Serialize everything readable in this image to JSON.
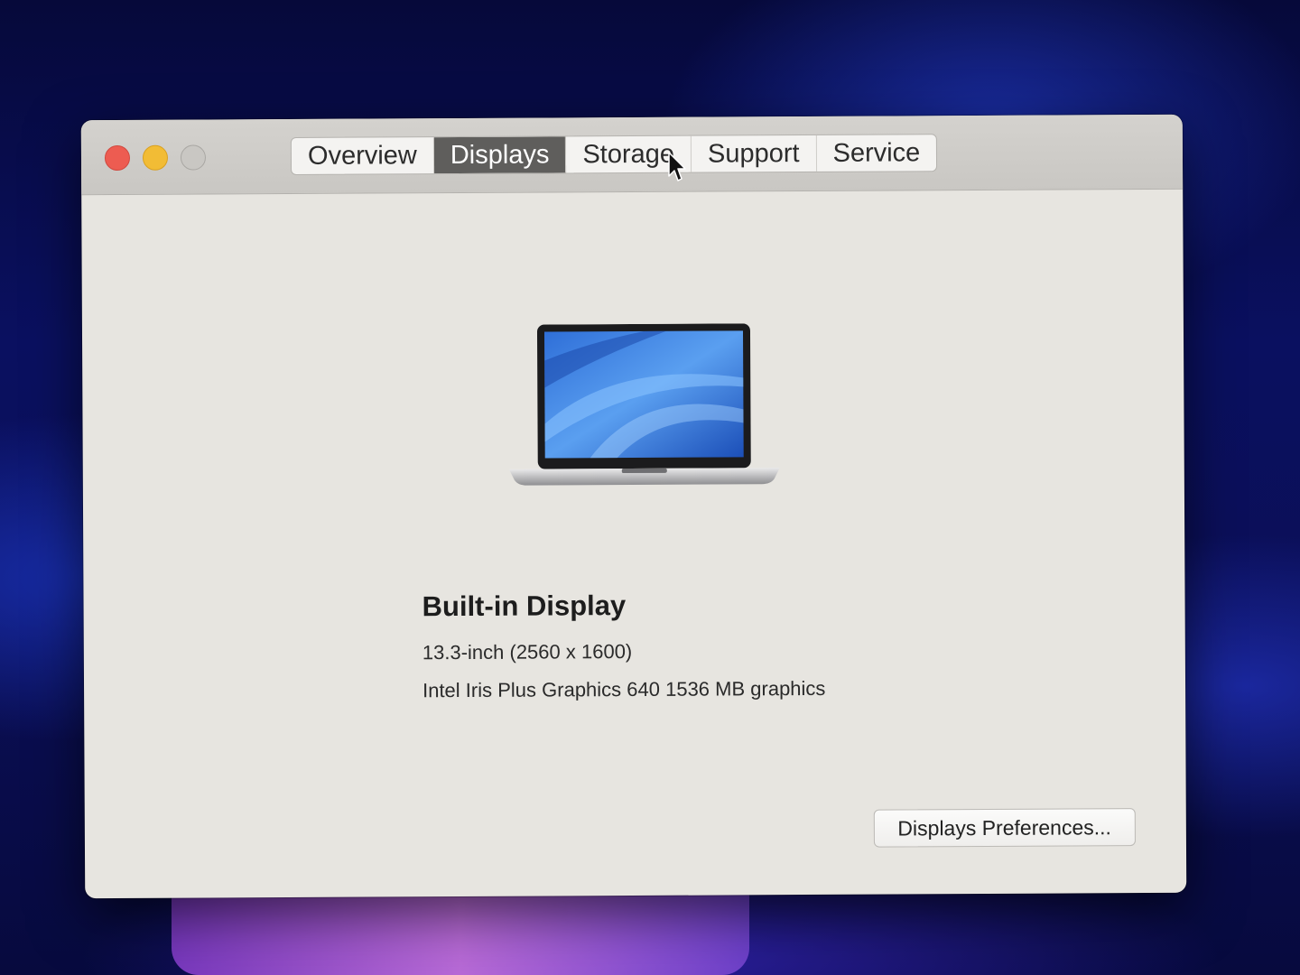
{
  "window": {
    "controls": {
      "close": "close",
      "minimize": "minimize",
      "zoom": "zoom"
    },
    "tabs": [
      {
        "label": "Overview",
        "active": false
      },
      {
        "label": "Displays",
        "active": true
      },
      {
        "label": "Storage",
        "active": false
      },
      {
        "label": "Support",
        "active": false
      },
      {
        "label": "Service",
        "active": false
      }
    ]
  },
  "display": {
    "image_icon": "macbook-laptop",
    "title": "Built-in Display",
    "size_resolution": "13.3-inch (2560 x 1600)",
    "graphics": "Intel Iris Plus Graphics 640 1536 MB graphics"
  },
  "actions": {
    "preferences_label": "Displays Preferences..."
  },
  "colors": {
    "window_bg": "#e7e5e0",
    "active_tab": "#5f5e5c",
    "close": "#ed5c51",
    "minimize": "#f2bc35",
    "zoom_disabled": "#c9c7c3"
  }
}
